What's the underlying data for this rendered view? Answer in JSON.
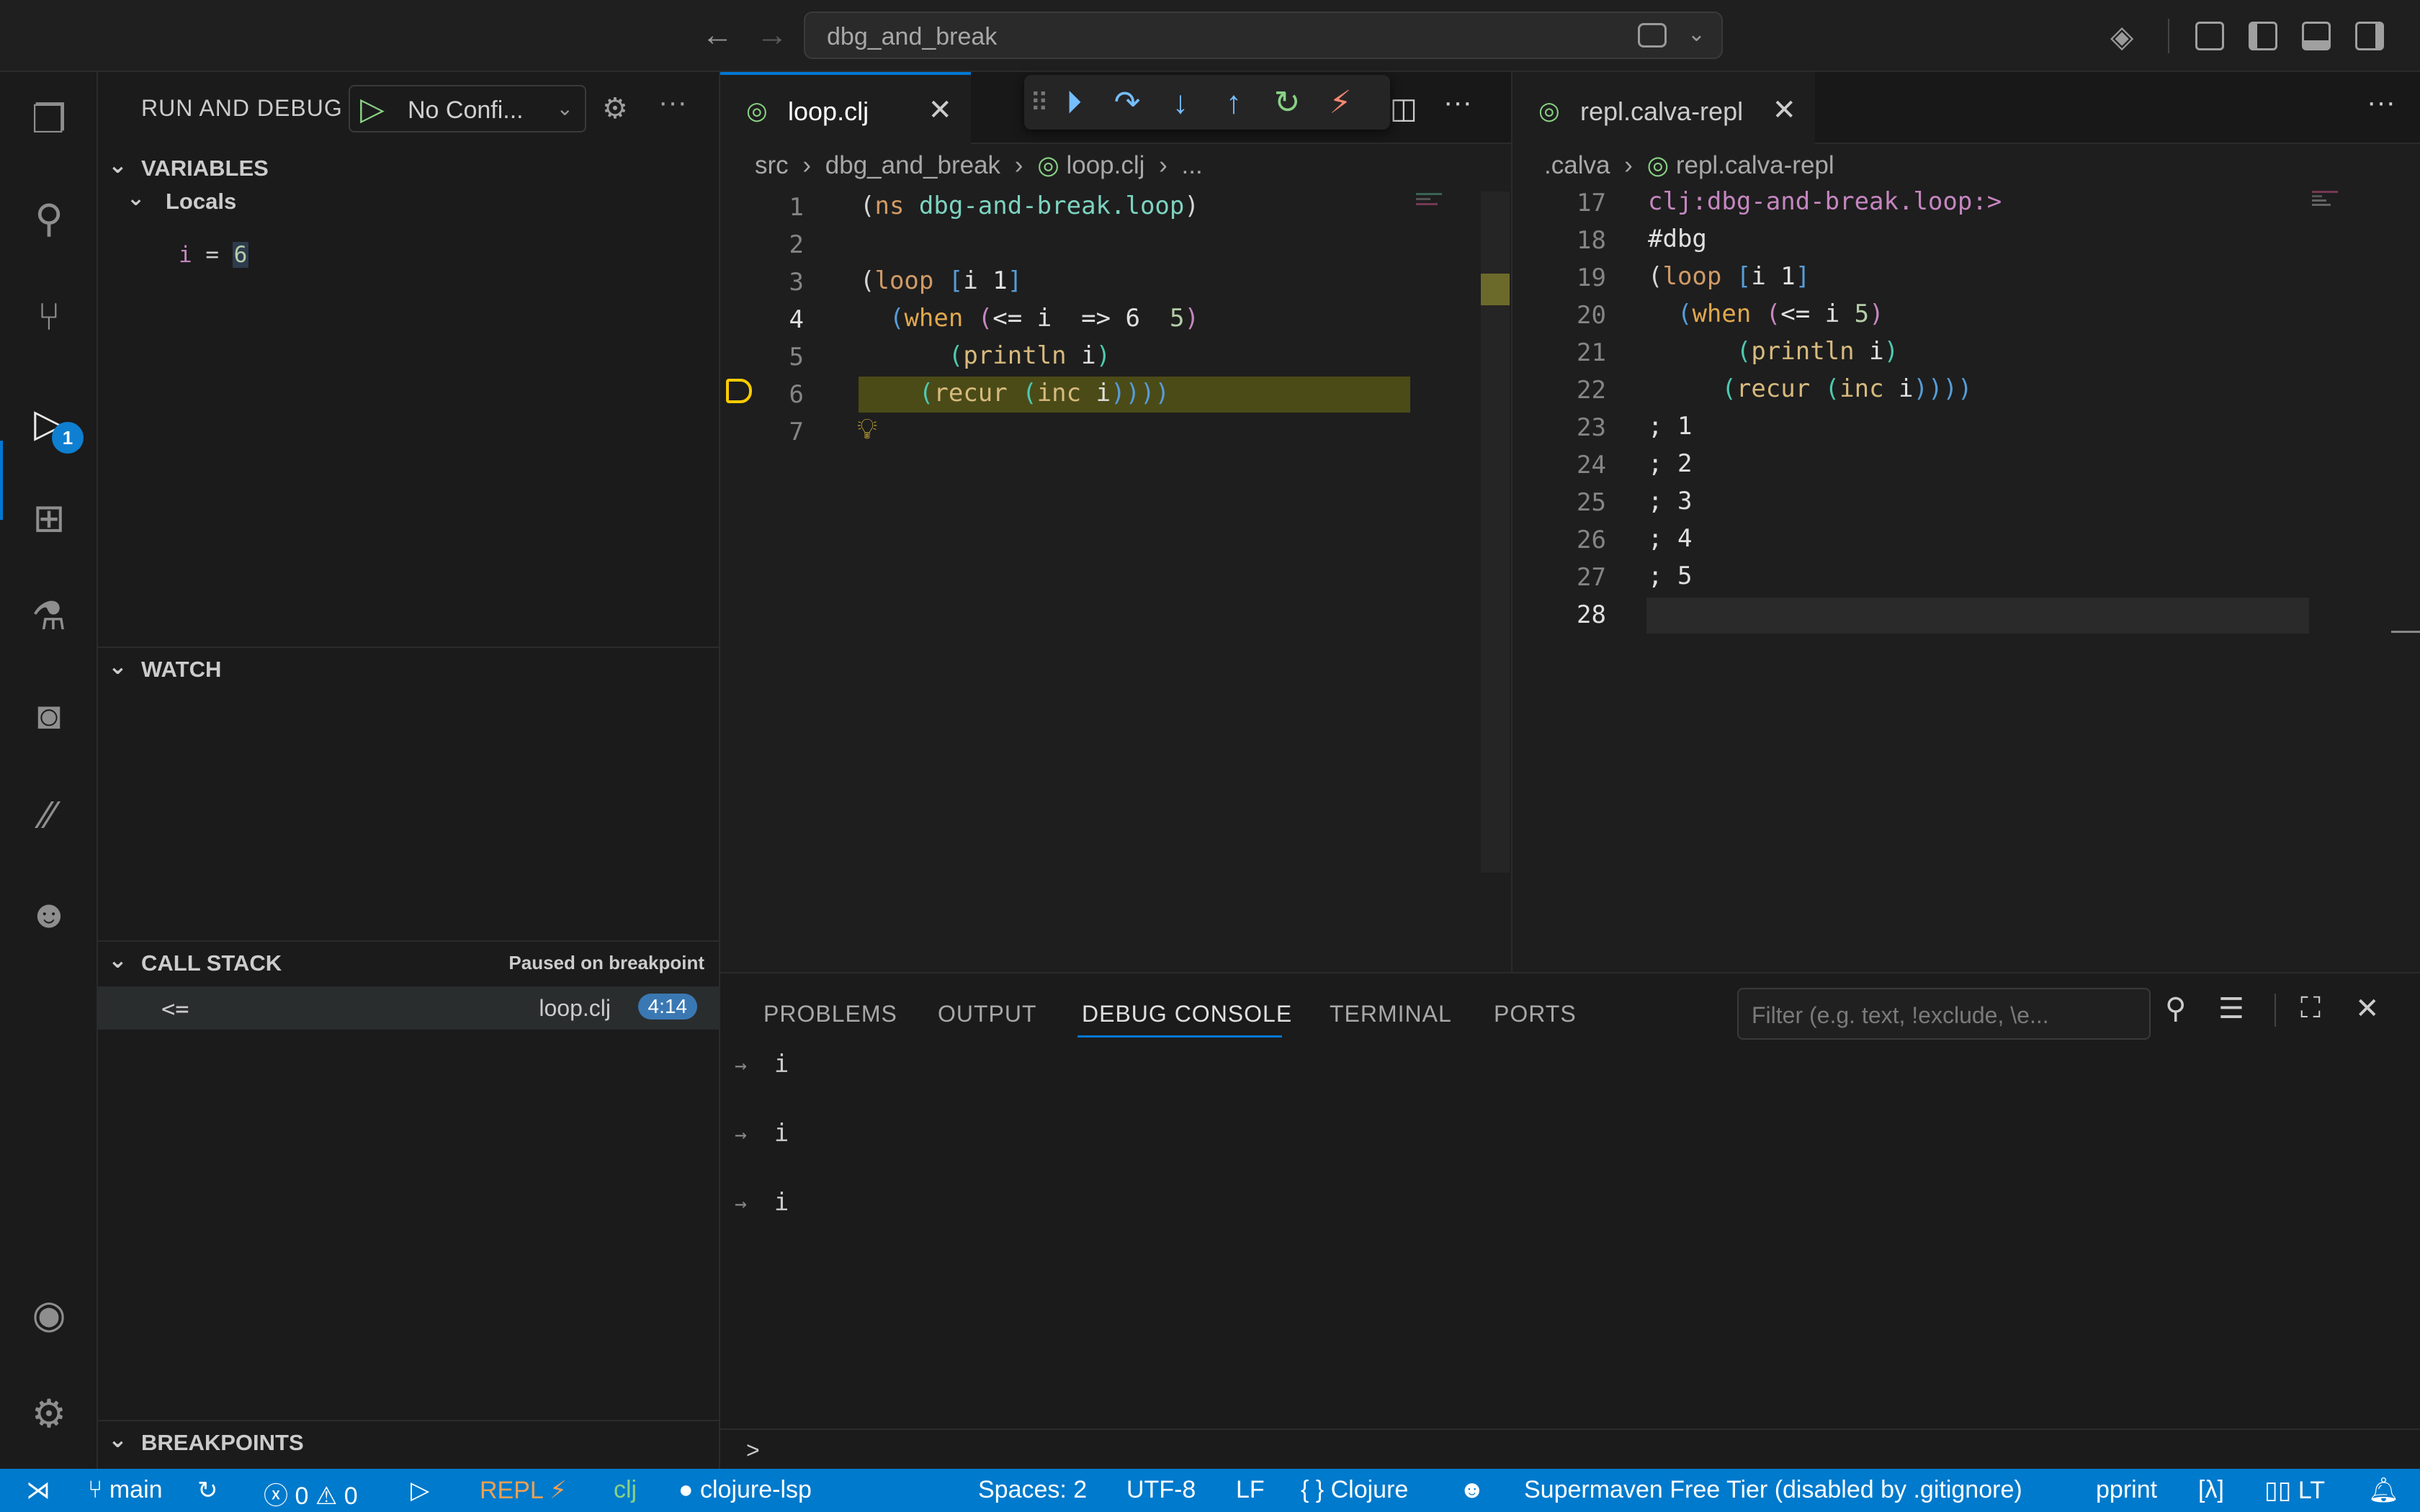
{
  "title_bar": {
    "command_center_text": "dbg_and_break"
  },
  "activity_bar": {
    "debug_badge": "1",
    "icons": [
      "explorer-icon",
      "search-icon",
      "source-control-icon",
      "run-debug-icon",
      "extensions-icon",
      "testing-icon",
      "calva-icon",
      "slash-icon",
      "copilot-icon",
      "account-icon",
      "settings-gear-icon"
    ]
  },
  "sidebar": {
    "title": "RUN AND DEBUG",
    "config_label": "No Confi...",
    "variables": {
      "header": "VARIABLES",
      "locals_label": "Locals",
      "var_name": "i",
      "var_eq": " = ",
      "var_value": "6"
    },
    "watch_header": "WATCH",
    "call_stack": {
      "header": "CALL STACK",
      "status": "Paused on breakpoint",
      "frame_fn": "<=",
      "frame_file": "loop.clj",
      "frame_loc": "4:14"
    },
    "breakpoints_header": "BREAKPOINTS"
  },
  "editor_left": {
    "tab_label": "loop.clj",
    "breadcrumb": [
      "src",
      "dbg_and_break",
      "loop.clj",
      "..."
    ],
    "line_numbers": [
      "1",
      "2",
      "3",
      "4",
      "5",
      "6",
      "7"
    ],
    "inline_value": "=> 6",
    "lines": {
      "l1": {
        "p1": "(",
        "kw": "ns",
        "ns": " dbg-and-break.loop",
        "p2": ")"
      },
      "l3": {
        "p1": "(",
        "kw": "loop",
        "p2": " [",
        "sym": "i 1",
        "p3": "]"
      },
      "l4": {
        "p1": "(",
        "kw": "when",
        "p2": " (",
        "sym": "<= i",
        "num": "5",
        "p3": ")"
      },
      "l5": {
        "p1": "(",
        "fn": "println",
        "sym": " i",
        "p2": ")"
      },
      "l6": {
        "p1": "(",
        "fn": "recur",
        "p2": " (",
        "fn2": "inc",
        "sym": " i",
        "p3": "))))"
      }
    }
  },
  "editor_right": {
    "tab_label": "repl.calva-repl",
    "breadcrumb": [
      ".calva",
      "repl.calva-repl"
    ],
    "line_numbers": [
      "17",
      "18",
      "19",
      "20",
      "21",
      "22",
      "23",
      "24",
      "25",
      "26",
      "27",
      "28"
    ],
    "prompt_ns": "clj:dbg-and-break.loop:>",
    "dbg": "#dbg",
    "outputs": [
      "; 1",
      "; 2",
      "; 3",
      "; 4",
      "; 5"
    ]
  },
  "panel": {
    "tabs": [
      "PROBLEMS",
      "OUTPUT",
      "DEBUG CONSOLE",
      "TERMINAL",
      "PORTS"
    ],
    "active_tab": "DEBUG CONSOLE",
    "filter_placeholder": "Filter (e.g. text, !exclude, \\e...",
    "console_entries": [
      "i",
      "i",
      "i"
    ],
    "input_prompt": ">"
  },
  "status_bar": {
    "branch": "main",
    "errors": "0",
    "warnings": "0",
    "repl": "REPL",
    "lang_short": "clj",
    "lsp": "clojure-lsp",
    "spaces": "Spaces: 2",
    "encoding": "UTF-8",
    "eol": "LF",
    "language": "Clojure",
    "supermaven": "Supermaven Free Tier (disabled by .gitignore)",
    "pprint": "pprint",
    "lambda": "[λ]",
    "lt": "LT",
    "brand_color": "#007acc"
  },
  "colors": {
    "accent": "#0078d4",
    "breakpoint": "#ffcc00",
    "current_line": "#4b4b18"
  }
}
